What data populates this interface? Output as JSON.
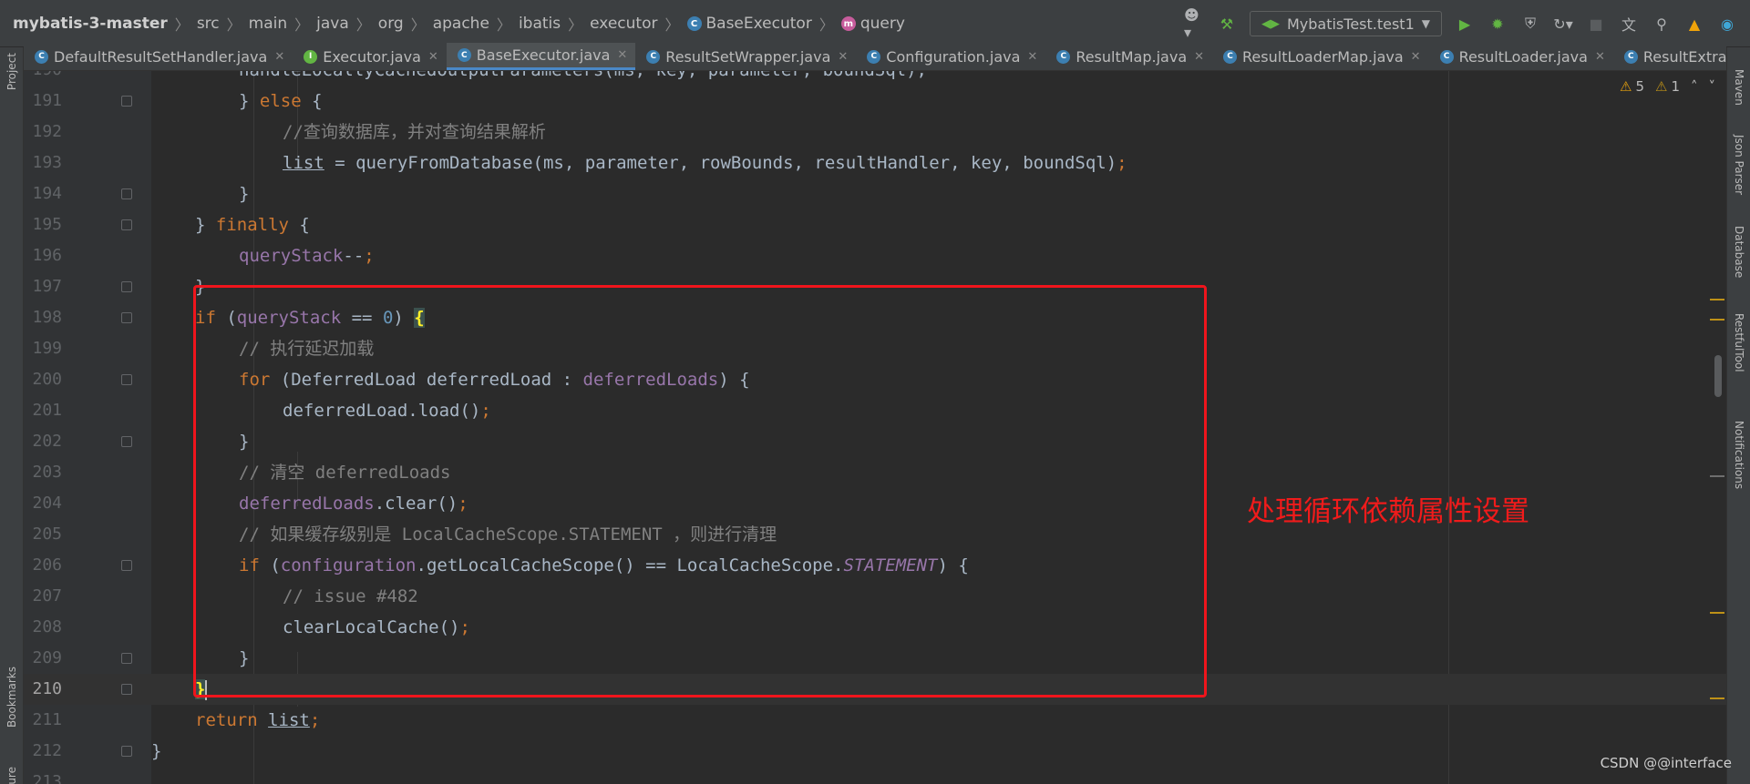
{
  "breadcrumbs": [
    "mybatis-3-master",
    "src",
    "main",
    "java",
    "org",
    "apache",
    "ibatis",
    "executor",
    "BaseExecutor",
    "query"
  ],
  "toolbar": {
    "run_config": "MybatisTest.test1"
  },
  "left_strip": {
    "project_label": "Project",
    "bookmarks_label": "Bookmarks",
    "structure_label": "ure"
  },
  "right_strip": {
    "maven_label": "Maven",
    "json_label": "Json Parser",
    "database_label": "Database",
    "restful_label": "RestfulTool",
    "notifications_label": "Notifications"
  },
  "tabs": [
    {
      "label": "DefaultResultSetHandler.java",
      "icon": "class-icon",
      "active": false
    },
    {
      "label": "Executor.java",
      "icon": "interface-icon",
      "active": false
    },
    {
      "label": "BaseExecutor.java",
      "icon": "class-icon",
      "active": true
    },
    {
      "label": "ResultSetWrapper.java",
      "icon": "class-icon",
      "active": false
    },
    {
      "label": "Configuration.java",
      "icon": "class-icon",
      "active": false
    },
    {
      "label": "ResultMap.java",
      "icon": "class-icon",
      "active": false
    },
    {
      "label": "ResultLoaderMap.java",
      "icon": "class-icon",
      "active": false
    },
    {
      "label": "ResultLoader.java",
      "icon": "class-icon",
      "active": false
    },
    {
      "label": "ResultExtractor.ja",
      "icon": "class-icon",
      "active": false
    }
  ],
  "inspections": {
    "warnings": "5",
    "weak_warnings": "1"
  },
  "code": {
    "line_numbers": [
      "190",
      "191",
      "192",
      "193",
      "194",
      "195",
      "196",
      "197",
      "198",
      "199",
      "200",
      "201",
      "202",
      "203",
      "204",
      "205",
      "206",
      "207",
      "208",
      "209",
      "210",
      "211",
      "212",
      "213"
    ],
    "l190": "handleLocallyCachedOutputParameters(ms, key, parameter, boundSql);",
    "else_kw": "else",
    "l192_comment": "//查询数据库，并对查询结果解析",
    "list_var": "list",
    "l193_call": "queryFromDatabase(ms, parameter, rowBounds, resultHandler, key, boundSql)",
    "finally_kw": "finally",
    "queryStack": "queryStack",
    "if_kw": "if",
    "zero": "0",
    "l199_comment": "// 执行延迟加载",
    "for_kw": "for",
    "deferred_type": "DeferredLoad deferredLoad : ",
    "deferredLoads": "deferredLoads",
    "l201": "deferredLoad.load()",
    "l203_comment": "// 清空 deferredLoads",
    "clear_call": ".clear()",
    "l205_comment": "// 如果缓存级别是 LocalCacheScope.STATEMENT ，则进行清理",
    "configuration": "configuration",
    "l206_mid": ".getLocalCacheScope() == LocalCacheScope.",
    "statement": "STATEMENT",
    "l207_comment": "// issue #482",
    "l208": "clearLocalCache()",
    "return_kw": "return"
  },
  "annotation": {
    "text": "处理循环依赖属性设置",
    "color": "#f01b1b"
  },
  "watermark": "CSDN @@interface",
  "colors": {
    "keyword": "#cc7832",
    "field": "#9876aa",
    "number": "#6897bb",
    "comment": "#808080",
    "text": "#a9b7c6",
    "background": "#2b2b2b"
  }
}
